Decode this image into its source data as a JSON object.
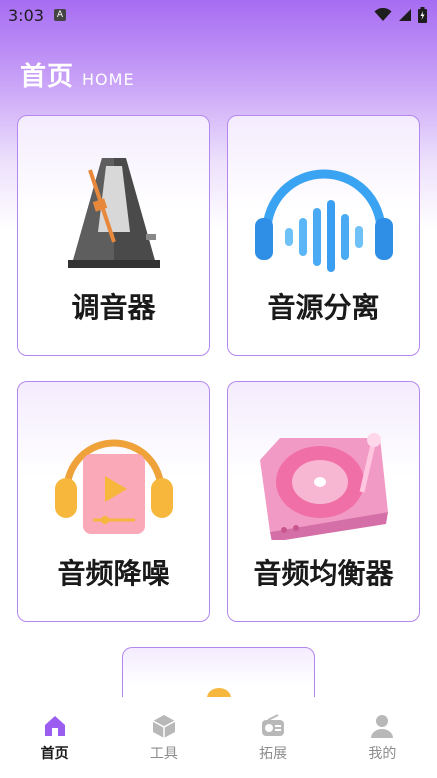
{
  "status_bar": {
    "time": "3:03",
    "app_icon": "A"
  },
  "header": {
    "title": "首页",
    "subtitle": "HOME"
  },
  "cards": [
    {
      "label": "调音器",
      "icon": "metronome-icon"
    },
    {
      "label": "音源分离",
      "icon": "headphones-waveform-icon"
    },
    {
      "label": "音频降噪",
      "icon": "headphones-player-icon"
    },
    {
      "label": "音频均衡器",
      "icon": "turntable-icon"
    },
    {
      "label": "",
      "icon": "partial-card-icon"
    }
  ],
  "bottom_nav": {
    "items": [
      {
        "label": "首页",
        "icon": "home-icon",
        "active": true
      },
      {
        "label": "工具",
        "icon": "cube-icon",
        "active": false
      },
      {
        "label": "拓展",
        "icon": "radio-icon",
        "active": false
      },
      {
        "label": "我的",
        "icon": "user-icon",
        "active": false
      }
    ]
  },
  "colors": {
    "accent": "#9b5cf0",
    "card_border": "#b487ee",
    "nav_active": "#1a1a1a",
    "nav_inactive": "#8c8c8c"
  }
}
